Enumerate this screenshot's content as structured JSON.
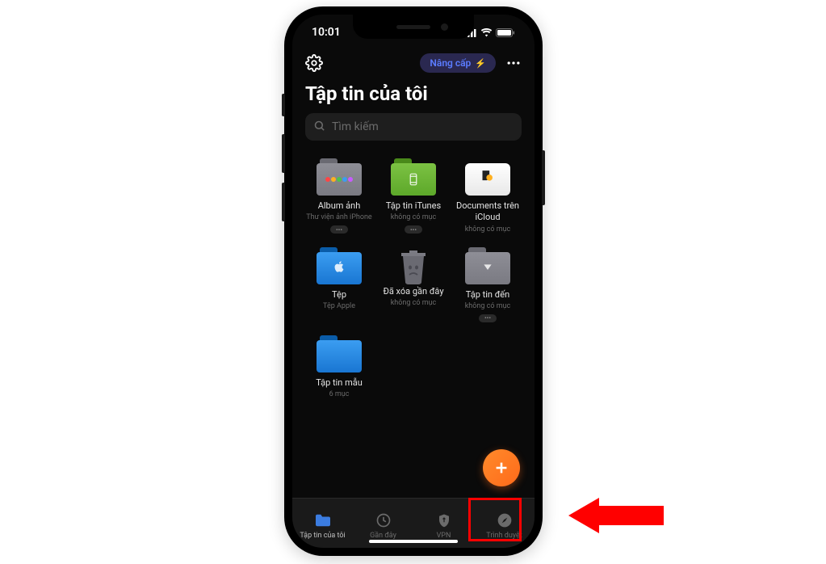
{
  "status": {
    "time": "10:01"
  },
  "header": {
    "upgrade_label": "Nâng cấp"
  },
  "page_title": "Tập tin của tôi",
  "search": {
    "placeholder": "Tìm kiếm"
  },
  "items": [
    {
      "label": "Album ảnh",
      "sub": "Thư viện ảnh iPhone",
      "has_more": true
    },
    {
      "label": "Tập tin iTunes",
      "sub": "không có mục",
      "has_more": true
    },
    {
      "label": "Documents trên iCloud",
      "sub": "không có mục",
      "has_more": false
    },
    {
      "label": "Tệp",
      "sub": "Tệp Apple",
      "has_more": false
    },
    {
      "label": "Đã xóa gần đây",
      "sub": "không có mục",
      "has_more": false
    },
    {
      "label": "Tập tin đến",
      "sub": "không có mục",
      "has_more": true
    },
    {
      "label": "Tập tin mẫu",
      "sub": "6 mục",
      "has_more": false
    }
  ],
  "tabs": [
    {
      "label": "Tập tin của tôi"
    },
    {
      "label": "Gần đây"
    },
    {
      "label": "VPN"
    },
    {
      "label": "Trình duyệt"
    }
  ]
}
